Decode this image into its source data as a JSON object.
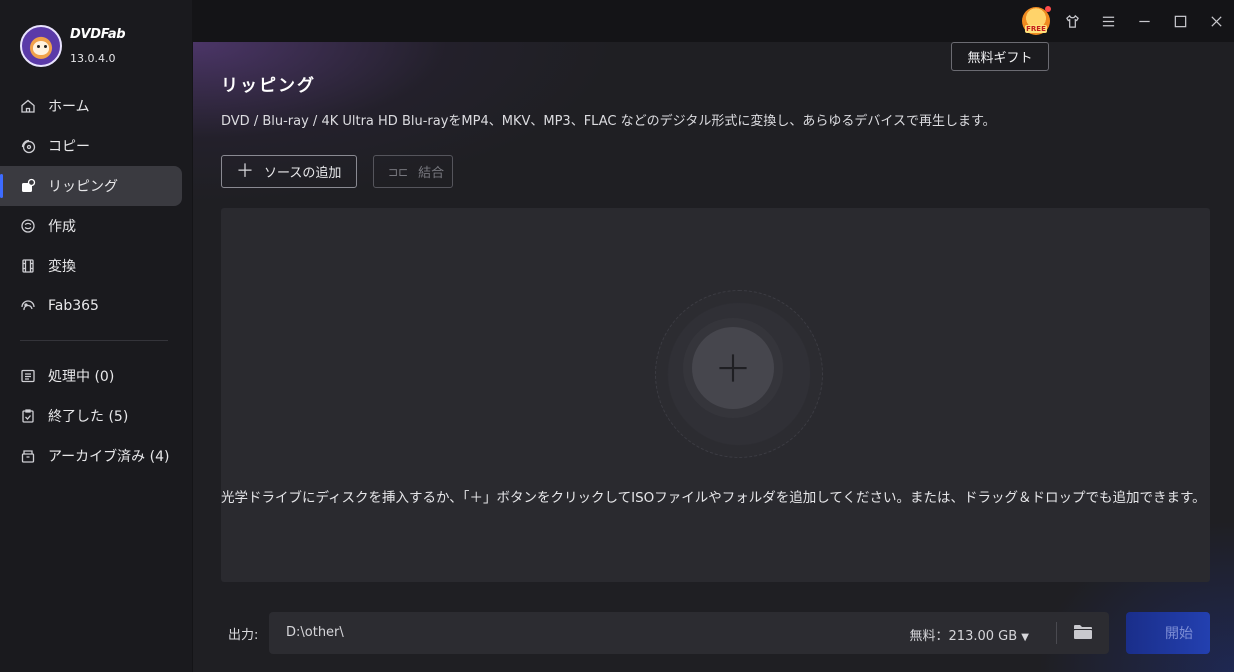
{
  "app": {
    "name": "DVDFab",
    "version": "13.0.4.0"
  },
  "sidebar": {
    "nav": [
      {
        "label": "ホーム",
        "icon": "home-icon"
      },
      {
        "label": "コピー",
        "icon": "copy-disc-icon"
      },
      {
        "label": "リッピング",
        "icon": "ripper-icon",
        "active": true
      },
      {
        "label": "作成",
        "icon": "creator-disc-icon"
      },
      {
        "label": "変換",
        "icon": "film-icon"
      },
      {
        "label": "Fab365",
        "icon": "fab365-icon"
      }
    ],
    "queue": [
      {
        "label": "処理中 (0)",
        "icon": "processing-list-icon"
      },
      {
        "label": "終了した (5)",
        "icon": "finished-clipboard-icon"
      },
      {
        "label": "アーカイブ済み (4)",
        "icon": "archive-box-icon"
      }
    ]
  },
  "topbar": {
    "gift_badge": "FREE",
    "tooltip": "無料ギフト"
  },
  "main": {
    "title": "リッピング",
    "description": "DVD / Blu-ray / 4K Ultra HD Blu-rayをMP4、MKV、MP3、FLAC などのデジタル形式に変換し、あらゆるデバイスで再生します。",
    "add_source": "ソースの追加",
    "merge": "結合",
    "drop_hint": "光学ドライブにディスクを挿入するか、「＋」ボタンをクリックしてISOファイルやフォルダを追加してください。または、ドラッグ＆ドロップでも追加できます。"
  },
  "output": {
    "label": "出力:",
    "path": "D:\\other\\",
    "free_space": "無料：213.00 GB",
    "start": "開始"
  },
  "colors": {
    "accent": "#3d6bff",
    "start_button": "#2340b0"
  }
}
